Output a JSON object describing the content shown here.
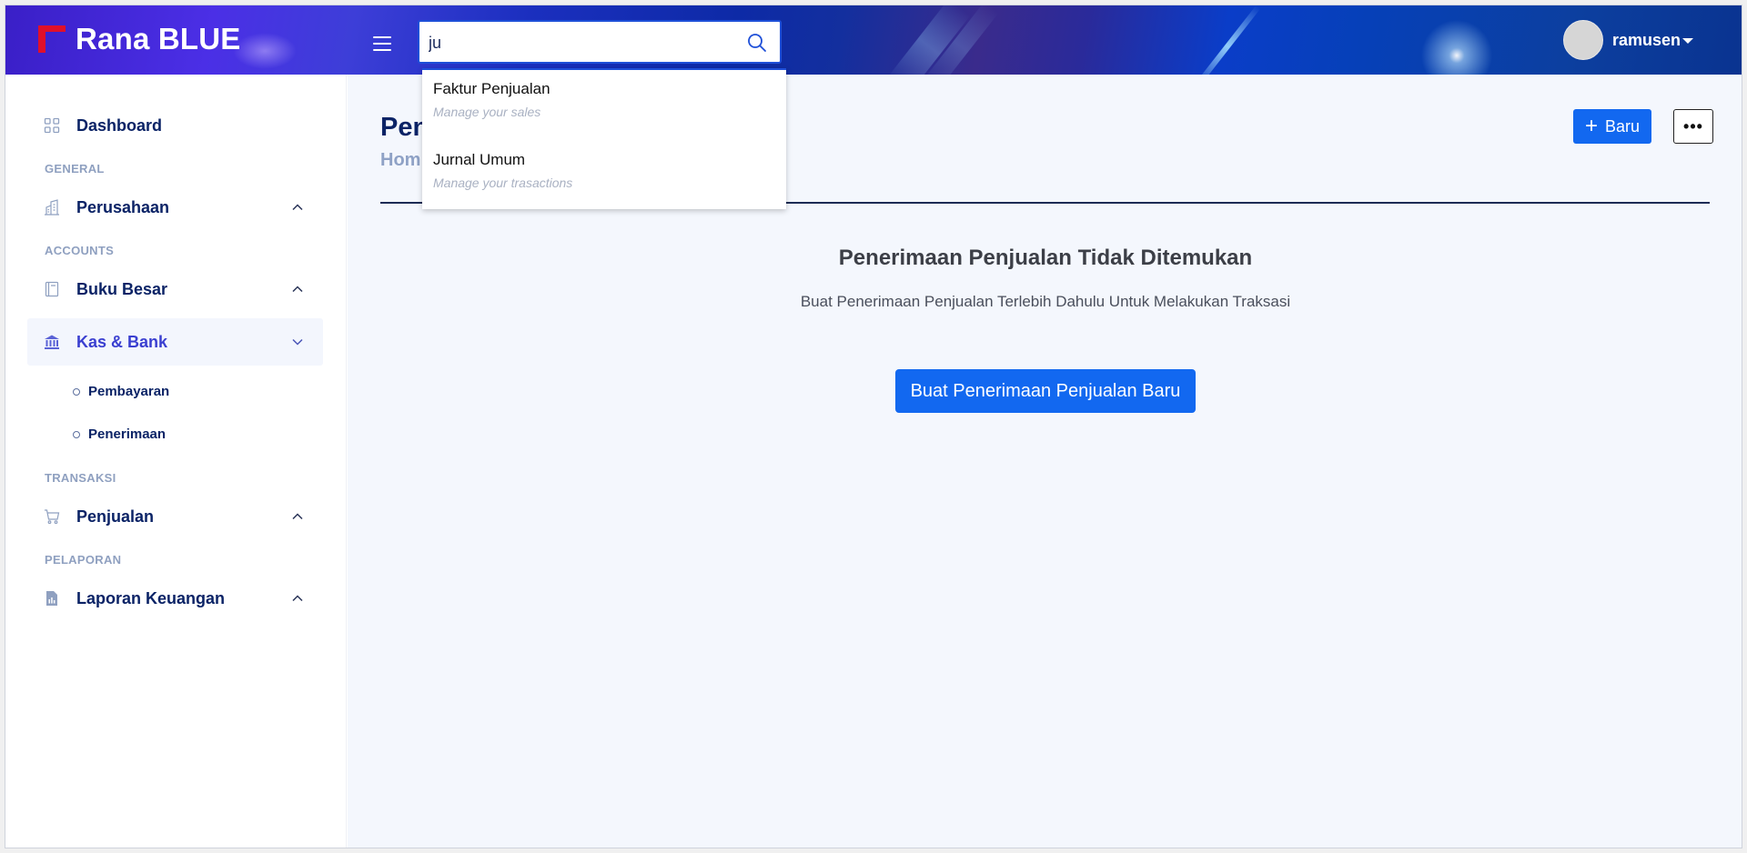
{
  "header": {
    "app_name": "Rana BLUE",
    "search": {
      "value": "ju",
      "placeholder": ""
    },
    "user": {
      "name": "ramusen"
    }
  },
  "search_results": [
    {
      "title": "Faktur Penjualan",
      "subtitle": "Manage your sales"
    },
    {
      "title": "Jurnal Umum",
      "subtitle": "Manage your trasactions"
    }
  ],
  "sidebar": {
    "dashboard": "Dashboard",
    "sections": {
      "general": "GENERAL",
      "accounts": "ACCOUNTS",
      "transaksi": "TRANSAKSI",
      "pelaporan": "PELAPORAN"
    },
    "items": {
      "perusahaan": "Perusahaan",
      "buku_besar": "Buku Besar",
      "kas_bank": "Kas & Bank",
      "penjualan": "Penjualan",
      "laporan_keuangan": "Laporan Keuangan"
    },
    "kas_bank_children": {
      "pembayaran": "Pembayaran",
      "penerimaan": "Penerimaan"
    }
  },
  "main": {
    "page_title": "Pen",
    "breadcrumb": "Hom",
    "new_button": "Baru",
    "more_button": "•••",
    "empty_title": "Penerimaan Penjualan Tidak Ditemukan",
    "empty_subtitle": "Buat Penerimaan Penjualan Terlebih Dahulu Untuk Melakukan Traksasi",
    "create_button": "Buat Penerimaan Penjualan Baru"
  },
  "colors": {
    "primary": "#1268f0",
    "nav_text": "#0b2366",
    "active_text": "#3a3fd0",
    "logo_red": "#e0102a"
  }
}
